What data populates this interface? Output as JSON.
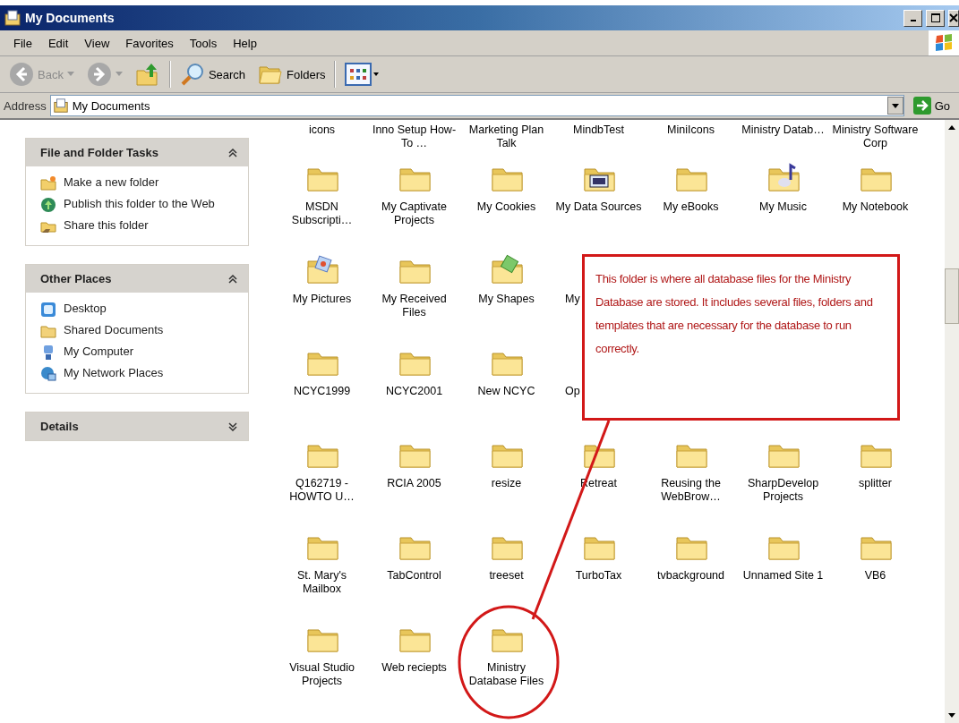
{
  "window": {
    "title": "My Documents"
  },
  "menu": [
    "File",
    "Edit",
    "View",
    "Favorites",
    "Tools",
    "Help"
  ],
  "toolbar": [
    {
      "kind": "back",
      "label": "Back",
      "disabled": true
    },
    {
      "kind": "forward",
      "disabled": true
    },
    {
      "kind": "up",
      "disabled": false
    },
    {
      "kind": "search",
      "label": "Search",
      "disabled": false
    },
    {
      "kind": "folders",
      "label": "Folders",
      "disabled": false
    },
    {
      "kind": "views",
      "disabled": false
    }
  ],
  "address": {
    "label": "Address",
    "value": "My Documents",
    "go": "Go"
  },
  "sidebar": [
    {
      "title": "File and Folder Tasks",
      "expanded": true,
      "items": [
        {
          "kind": "new-folder",
          "label": "Make a new folder"
        },
        {
          "kind": "publish",
          "label": "Publish this folder to the Web"
        },
        {
          "kind": "share",
          "label": "Share this folder"
        }
      ]
    },
    {
      "title": "Other Places",
      "expanded": true,
      "items": [
        {
          "kind": "desktop",
          "label": "Desktop"
        },
        {
          "kind": "shared",
          "label": "Shared Documents"
        },
        {
          "kind": "computer",
          "label": "My Computer"
        },
        {
          "kind": "network",
          "label": "My Network Places"
        }
      ]
    },
    {
      "title": "Details",
      "expanded": false
    }
  ],
  "rows": [
    [
      {
        "kind": "label-only",
        "label": "icons"
      },
      {
        "kind": "label-only",
        "label": "Inno Setup How-To …"
      },
      {
        "kind": "label-only",
        "label": "Marketing Plan Talk"
      },
      {
        "kind": "label-only",
        "label": "MindbTest"
      },
      {
        "kind": "label-only",
        "label": "MiniIcons"
      },
      {
        "kind": "label-only",
        "label": "Ministry Datab…"
      },
      {
        "kind": "label-only",
        "label": "Ministry Software Corp"
      }
    ],
    [
      {
        "kind": "folder",
        "label": "MSDN Subscripti…"
      },
      {
        "kind": "folder",
        "label": "My Captivate Projects"
      },
      {
        "kind": "folder",
        "label": "My Cookies"
      },
      {
        "kind": "data",
        "label": "My Data Sources"
      },
      {
        "kind": "folder",
        "label": "My eBooks"
      },
      {
        "kind": "music",
        "label": "My Music"
      },
      {
        "kind": "folder",
        "label": "My Notebook"
      }
    ],
    [
      {
        "kind": "pictures",
        "label": "My Pictures"
      },
      {
        "kind": "folder",
        "label": "My Received Files"
      },
      {
        "kind": "shapes",
        "label": "My Shapes"
      },
      {
        "kind": "covered",
        "label": "My"
      }
    ],
    [
      {
        "kind": "folder",
        "label": "NCYC1999"
      },
      {
        "kind": "folder",
        "label": "NCYC2001"
      },
      {
        "kind": "folder",
        "label": "New NCYC"
      },
      {
        "kind": "covered",
        "label": "Op"
      }
    ],
    [
      {
        "kind": "folder",
        "label": "Q162719 - HOWTO U…"
      },
      {
        "kind": "folder",
        "label": "RCIA 2005"
      },
      {
        "kind": "folder",
        "label": "resize"
      },
      {
        "kind": "folder",
        "label": "Retreat"
      },
      {
        "kind": "folder",
        "label": "Reusing the WebBrow…"
      },
      {
        "kind": "folder",
        "label": "SharpDevelop Projects"
      },
      {
        "kind": "folder",
        "label": "splitter"
      }
    ],
    [
      {
        "kind": "folder",
        "label": "St. Mary's Mailbox"
      },
      {
        "kind": "folder",
        "label": "TabControl"
      },
      {
        "kind": "folder",
        "label": "treeset"
      },
      {
        "kind": "folder",
        "label": "TurboTax"
      },
      {
        "kind": "folder",
        "label": "tvbackground"
      },
      {
        "kind": "folder",
        "label": "Unnamed Site 1"
      },
      {
        "kind": "folder",
        "label": "VB6"
      }
    ],
    [
      {
        "kind": "folder",
        "label": "Visual Studio Projects"
      },
      {
        "kind": "folder",
        "label": "Web reciepts"
      },
      {
        "kind": "folder",
        "label": "Ministry Database Files"
      }
    ]
  ],
  "annotation": {
    "text": "This folder is where all database files for the Ministry Database are stored.  It includes several files, folders and templates that are necessary for the database to run correctly."
  }
}
